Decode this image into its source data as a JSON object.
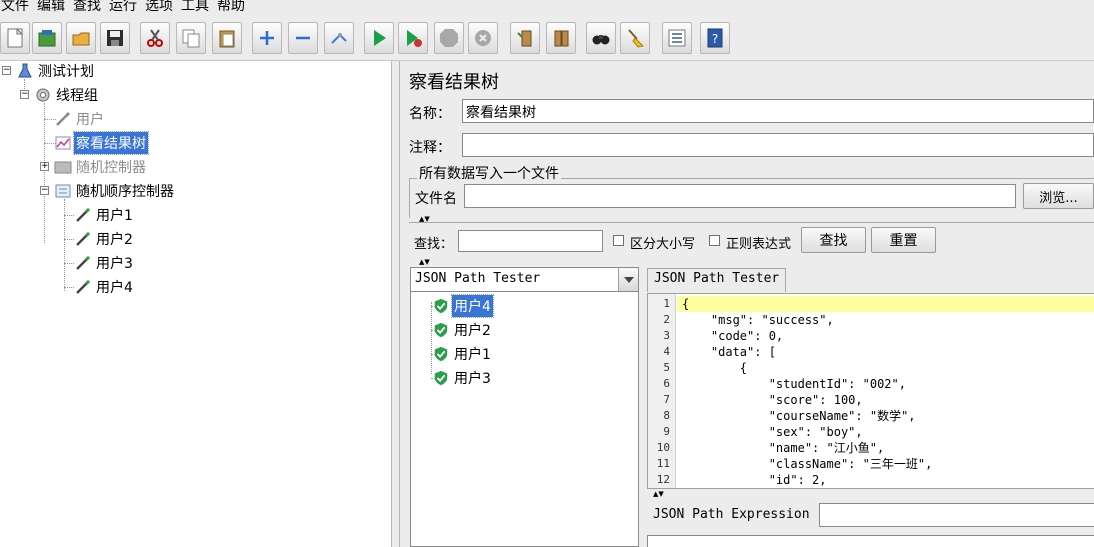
{
  "menubar": {
    "items": [
      "文件",
      "编辑",
      "查找",
      "运行",
      "选项",
      "工具",
      "帮助"
    ]
  },
  "toolbar": {
    "buttons": [
      {
        "icon": "new-icon"
      },
      {
        "icon": "templates-icon"
      },
      {
        "icon": "open-icon"
      },
      {
        "icon": "save-icon"
      },
      {
        "icon": "cut-icon"
      },
      {
        "icon": "copy-icon"
      },
      {
        "icon": "paste-icon"
      },
      {
        "icon": "expand-icon"
      },
      {
        "icon": "collapse-icon"
      },
      {
        "icon": "toggle-icon"
      },
      {
        "icon": "start-icon"
      },
      {
        "icon": "start-no-pauses-icon"
      },
      {
        "icon": "stop-icon"
      },
      {
        "icon": "shutdown-icon"
      },
      {
        "icon": "clear-icon"
      },
      {
        "icon": "clear-all-icon"
      },
      {
        "icon": "search-icon"
      },
      {
        "icon": "reset-search-icon"
      },
      {
        "icon": "function-helper-icon"
      },
      {
        "icon": "help-icon"
      }
    ]
  },
  "tree": {
    "test_plan": "测试计划",
    "thread_group": "线程组",
    "user_disabled": "用户",
    "view_results_tree": "察看结果树",
    "random_controller": "随机控制器",
    "random_order_controller": "随机顺序控制器",
    "users": [
      "用户1",
      "用户2",
      "用户3",
      "用户4"
    ]
  },
  "panel": {
    "title": "察看结果树",
    "name_label": "名称：",
    "name_value": "察看结果树",
    "comment_label": "注释：",
    "comment_value": "",
    "fileset_legend": "所有数据写入一个文件",
    "filename_label": "文件名",
    "filename_value": "",
    "browse_label": "浏览..."
  },
  "search": {
    "label": "查找：",
    "value": "",
    "case_sensitive_label": "区分大小写",
    "regex_label": "正则表达式",
    "find_label": "查找",
    "reset_label": "重置"
  },
  "results": {
    "renderer": "JSON Path Tester",
    "samples": [
      "用户4",
      "用户2",
      "用户1",
      "用户3"
    ],
    "selected": "用户4"
  },
  "viewer": {
    "tab_label": "JSON Path Tester",
    "line_numbers": [
      "1",
      "2",
      "3",
      "4",
      "5",
      "6",
      "7",
      "8",
      "9",
      "10",
      "11",
      "12"
    ],
    "lines": [
      "{",
      "    \"msg\": \"success\",",
      "    \"code\": 0,",
      "    \"data\": [",
      "        {",
      "            \"studentId\": \"002\",",
      "            \"score\": 100,",
      "            \"courseName\": \"数学\",",
      "            \"sex\": \"boy\",",
      "            \"name\": \"江小鱼\",",
      "            \"className\": \"三年一班\",",
      "            \"id\": 2,"
    ],
    "expression_label": "JSON Path Expression",
    "expression_value": ""
  },
  "colors": {
    "selection": "#3875d7",
    "current_line": "#ffff9f",
    "background": "#ececec"
  }
}
